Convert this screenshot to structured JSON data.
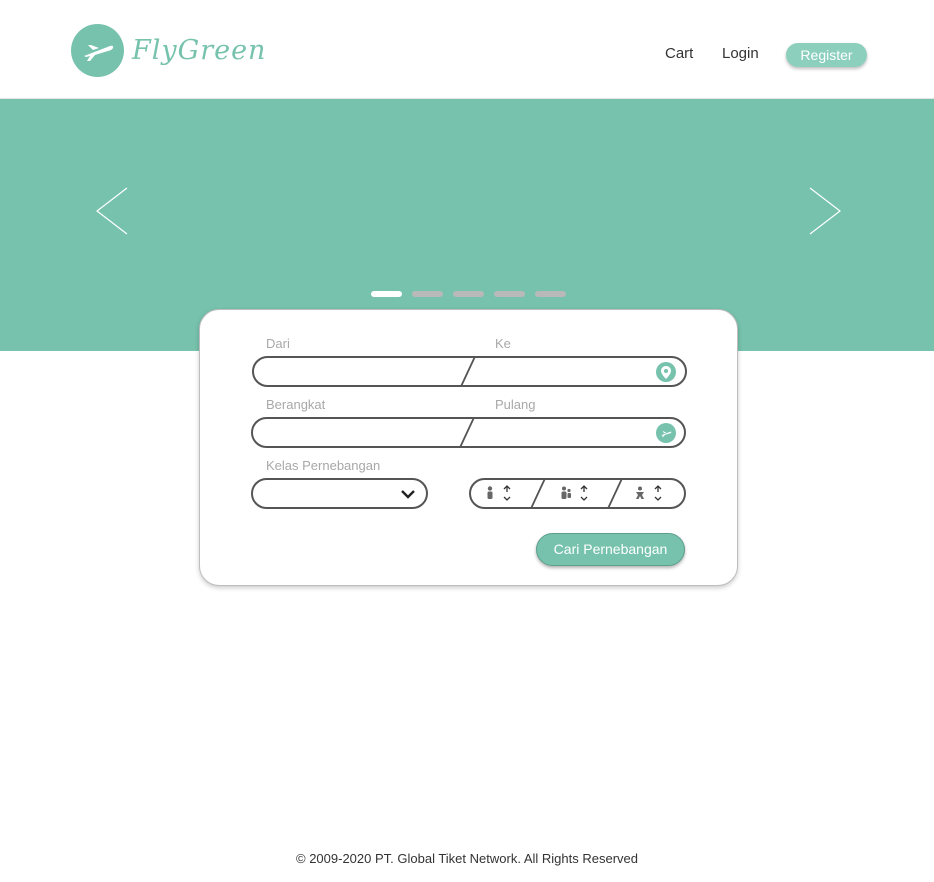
{
  "brand": {
    "name": "FlyGreen",
    "color": "#76c2ad",
    "logo_icon": "airplane-icon"
  },
  "nav": {
    "cart": "Cart",
    "login": "Login",
    "register": "Register"
  },
  "carousel": {
    "prev_icon": "chevron-left-icon",
    "next_icon": "chevron-right-icon",
    "slide_count": 5,
    "active_slide": 1
  },
  "search": {
    "from_label": "Dari",
    "to_label": "Ke",
    "location_icon": "map-pin-icon",
    "depart_label": "Berangkat",
    "return_label": "Pulang",
    "date_icon": "airplane-icon",
    "class_label": "Kelas Pernebangan",
    "class_value": "",
    "class_dropdown_icon": "chevron-down-icon",
    "passengers": [
      {
        "type": "adult",
        "icon": "adult-person-icon",
        "value": ""
      },
      {
        "type": "child",
        "icon": "child-person-icon",
        "value": ""
      },
      {
        "type": "infant",
        "icon": "infant-person-icon",
        "value": ""
      }
    ],
    "submit": "Cari Pernebangan"
  },
  "footer": {
    "copyright": "© 2009-2020 PT. Global Tiket Network. All Rights Reserved"
  }
}
